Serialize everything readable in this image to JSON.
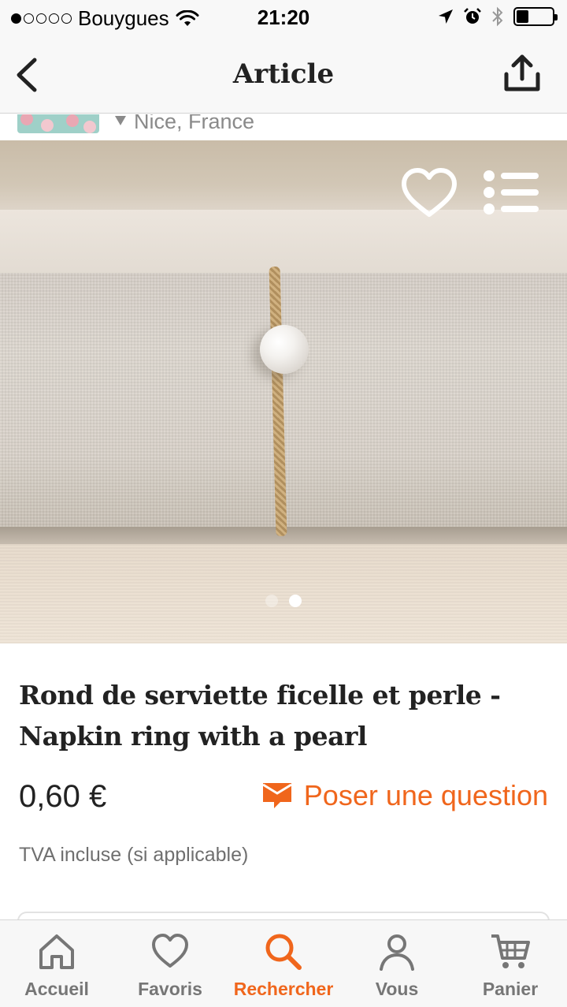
{
  "status_bar": {
    "carrier": "Bouygues",
    "time": "21:20",
    "signal_bars": 1,
    "signal_total": 5,
    "battery_level": 0.35
  },
  "nav": {
    "title": "Article",
    "back_icon": "chevron-left-icon",
    "share_icon": "share-upload-icon"
  },
  "shop": {
    "location": "Nice, France"
  },
  "gallery": {
    "image_count": 2,
    "active_index": 1
  },
  "product": {
    "title_line1": "Rond de serviette ficelle et perle -",
    "title_line2": "Napkin ring with a pearl",
    "price": "0,60 €",
    "ask_question": "Poser une question",
    "vat_note": "TVA incluse (si applicable)"
  },
  "tabs": [
    {
      "label": "Accueil",
      "icon": "home-icon",
      "active": false
    },
    {
      "label": "Favoris",
      "icon": "heart-icon",
      "active": false
    },
    {
      "label": "Rechercher",
      "icon": "search-icon",
      "active": true
    },
    {
      "label": "Vous",
      "icon": "user-icon",
      "active": false
    },
    {
      "label": "Panier",
      "icon": "cart-icon",
      "active": false
    }
  ],
  "colors": {
    "accent": "#f0661c",
    "tab_inactive": "#767676",
    "text": "#222222"
  }
}
